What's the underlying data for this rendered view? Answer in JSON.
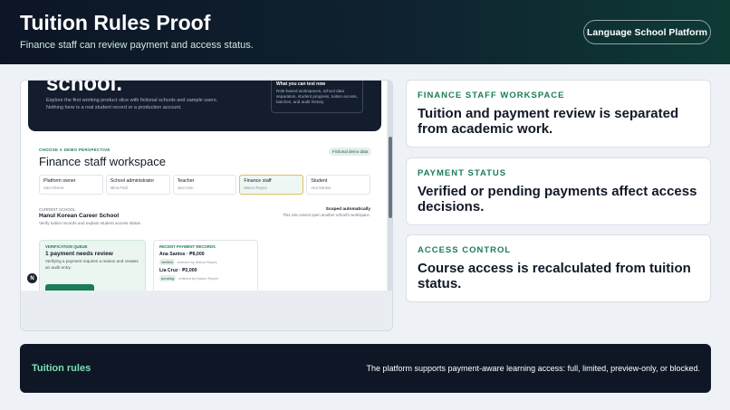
{
  "header": {
    "title": "Tuition Rules Proof",
    "subtitle": "Finance staff can review payment and access status.",
    "platform_button": "Language School Platform"
  },
  "screenshot": {
    "hero": {
      "title_fragment": "school.",
      "description": "Explore the first working product slice with fictional schools and sample users. Nothing here is a real student record or a production account.",
      "card_title": "What you can test now",
      "card_body": "Role-based workspaces, school data separation, student progress, tuition access, batches, and audit history."
    },
    "perspective": {
      "label": "CHOOSE A DEMO PERSPECTIVE",
      "badge": "Fictional demo data",
      "title": "Finance staff workspace",
      "roles": [
        {
          "name": "Platform owner",
          "person": "Sam Rivera"
        },
        {
          "name": "School administrator",
          "person": "Mina Park"
        },
        {
          "name": "Teacher",
          "person": "Jeon Kim"
        },
        {
          "name": "Finance staff",
          "person": "Marco Reyes"
        },
        {
          "name": "Student",
          "person": "Ana Santos"
        }
      ]
    },
    "school": {
      "label": "CURRENT SCHOOL",
      "name": "Hanul Korean Career School",
      "description": "Verify tuition records and explain student access status.",
      "scoped_title": "Scoped automatically",
      "scoped_desc": "This role cannot open another school's workspace."
    },
    "verification": {
      "label": "VERIFICATION QUEUE",
      "title": "1 payment needs review",
      "description": "Verifying a payment requires a reason and creates an audit entry."
    },
    "recent": {
      "label": "RECENT PAYMENT RECORDS",
      "records": [
        {
          "name": "Ana Santos · ₱8,000",
          "status": "verified",
          "by": "entered by Marco Reyes"
        },
        {
          "name": "Lia Cruz · ₱2,000",
          "status": "pending",
          "by": "entered by Marco Reyes"
        }
      ]
    },
    "avatar_letter": "N"
  },
  "cards": [
    {
      "label": "FINANCE STAFF WORKSPACE",
      "text": "Tuition and payment review is separated from academic work."
    },
    {
      "label": "PAYMENT STATUS",
      "text": "Verified or pending payments affect access decisions."
    },
    {
      "label": "ACCESS CONTROL",
      "text": "Course access is recalculated from tuition status."
    }
  ],
  "footer": {
    "title": "Tuition rules",
    "text": "The platform supports payment-aware learning access: full, limited, preview-only, or blocked."
  },
  "colors": {
    "accent_green": "#1a7d58",
    "header_dark": "#0c1525",
    "footer_dark": "#0f1727"
  }
}
